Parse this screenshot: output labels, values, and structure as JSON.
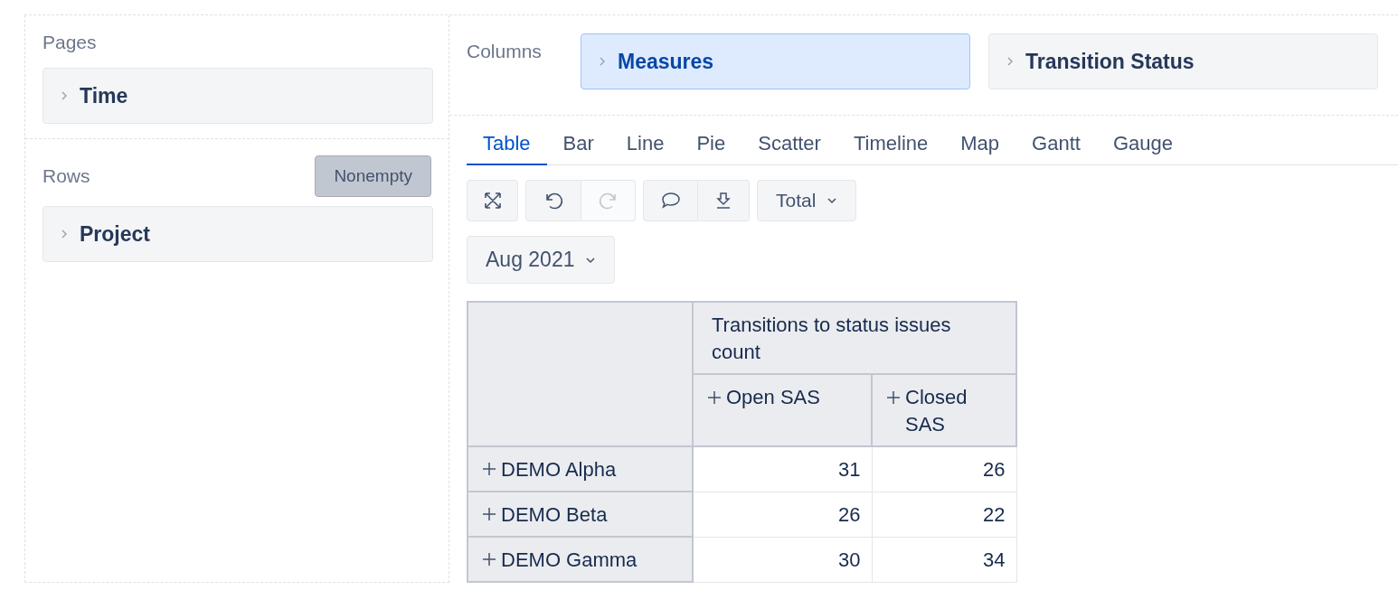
{
  "pages": {
    "title": "Pages",
    "items": [
      {
        "label": "Time",
        "selected": false
      }
    ]
  },
  "rows": {
    "title": "Rows",
    "nonempty": {
      "label": "Nonempty",
      "on": true
    },
    "items": [
      {
        "label": "Project",
        "selected": false
      }
    ]
  },
  "columns": {
    "title": "Columns",
    "items": [
      {
        "label": "Measures",
        "selected": true
      },
      {
        "label": "Transition Status",
        "selected": false
      }
    ]
  },
  "tabs": [
    {
      "label": "Table",
      "selected": true
    },
    {
      "label": "Bar",
      "selected": false
    },
    {
      "label": "Line",
      "selected": false
    },
    {
      "label": "Pie",
      "selected": false
    },
    {
      "label": "Scatter",
      "selected": false
    },
    {
      "label": "Timeline",
      "selected": false
    },
    {
      "label": "Map",
      "selected": false
    },
    {
      "label": "Gantt",
      "selected": false
    },
    {
      "label": "Gauge",
      "selected": false
    }
  ],
  "toolbar": {
    "undo": {
      "disabled": false
    },
    "redo": {
      "disabled": true
    },
    "total": "Total"
  },
  "page_filter": "Aug 2021",
  "table": {
    "measure": "Transitions to status issues count",
    "columns": [
      "Open SAS",
      "Closed SAS"
    ],
    "rows": [
      {
        "label": "DEMO Alpha",
        "values": [
          "31",
          "26"
        ]
      },
      {
        "label": "DEMO Beta",
        "values": [
          "26",
          "22"
        ]
      },
      {
        "label": "DEMO Gamma",
        "values": [
          "30",
          "34"
        ]
      }
    ]
  }
}
